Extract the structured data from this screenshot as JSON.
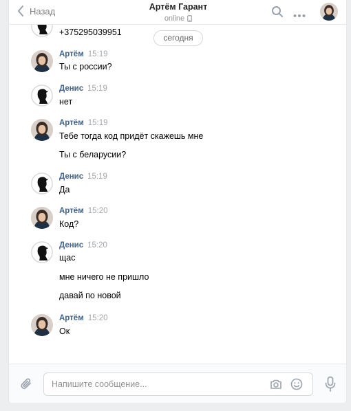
{
  "header": {
    "back_label": "Назад",
    "title": "Артём Гарант",
    "status": "online"
  },
  "feed": {
    "prev_line": "+375295039951",
    "date_divider": "сегодня",
    "messages": [
      {
        "author": "Артём",
        "time": "15:19",
        "lines": [
          "Ты с россии?"
        ]
      },
      {
        "author": "Денис",
        "time": "15:19",
        "lines": [
          "нет"
        ]
      },
      {
        "author": "Артём",
        "time": "15:19",
        "lines": [
          "Тебе тогда код придёт скажешь мне",
          "Ты с беларусии?"
        ]
      },
      {
        "author": "Денис",
        "time": "15:19",
        "lines": [
          "Да"
        ]
      },
      {
        "author": "Артём",
        "time": "15:20",
        "lines": [
          "Код?"
        ]
      },
      {
        "author": "Денис",
        "time": "15:20",
        "lines": [
          "щас",
          "мне ничего не пришло",
          "давай по новой"
        ]
      },
      {
        "author": "Артём",
        "time": "15:20",
        "lines": [
          "Ок"
        ]
      }
    ]
  },
  "composer": {
    "placeholder": "Напишите сообщение..."
  },
  "colors": {
    "author_link": "#42648b",
    "time": "#a1a5a9",
    "icon": "#99a2ad",
    "background": "#edeef0"
  },
  "icons": {
    "back": "chevron-left-icon",
    "search": "search-icon",
    "more": "more-dots-icon",
    "phone": "mobile-phone-icon",
    "attach": "paperclip-icon",
    "camera": "camera-icon",
    "emoji": "smiley-icon",
    "voice": "microphone-icon"
  }
}
